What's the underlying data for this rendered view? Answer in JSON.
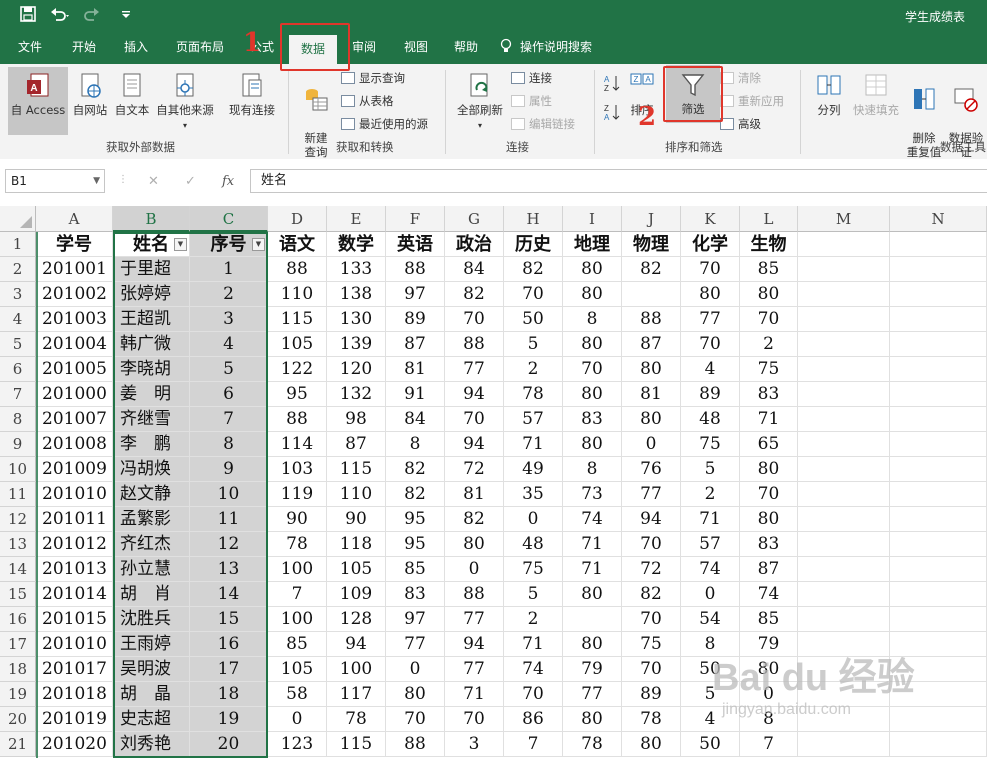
{
  "titlebar": {
    "doc_title": "学生成绩表"
  },
  "tabs": [
    "文件",
    "开始",
    "插入",
    "页面布局",
    "公式",
    "数据",
    "审阅",
    "视图",
    "帮助"
  ],
  "tell_me": "操作说明搜索",
  "ribbon": {
    "get_external": {
      "access": "自 Access",
      "web": "自网站",
      "text": "自文本",
      "other": "自其他来源",
      "existing": "现有连接",
      "group_label": "获取外部数据"
    },
    "get_transform": {
      "new_query": "新建\n查询",
      "show_queries": "显示查询",
      "from_table": "从表格",
      "recent_sources": "最近使用的源",
      "group_label": "获取和转换"
    },
    "connections": {
      "refresh_all": "全部刷新",
      "connections": "连接",
      "properties": "属性",
      "edit_links": "编辑链接",
      "group_label": "连接"
    },
    "sort_filter": {
      "sort": "排序",
      "filter": "筛选",
      "clear": "清除",
      "reapply": "重新应用",
      "advanced": "高级",
      "group_label": "排序和筛选"
    },
    "data_tools": {
      "split": "分列",
      "flash_fill": "快速填充",
      "remove_dup": "删除\n重复值",
      "validation": "数据验\n证",
      "group_label": "数据工具"
    }
  },
  "annotations": {
    "step1": "1",
    "step2": "2"
  },
  "formula_bar": {
    "name_box": "B1",
    "content": "姓名"
  },
  "columns": [
    "A",
    "B",
    "C",
    "D",
    "E",
    "F",
    "G",
    "H",
    "I",
    "J",
    "K",
    "L",
    "M",
    "N"
  ],
  "header_row": [
    "学号",
    "姓名",
    "序号",
    "语文",
    "数学",
    "英语",
    "政治",
    "历史",
    "地理",
    "物理",
    "化学",
    "生物",
    "",
    ""
  ],
  "rows": [
    [
      "201001",
      "于里超",
      "1",
      "88",
      "133",
      "88",
      "84",
      "82",
      "80",
      "82",
      "70",
      "85"
    ],
    [
      "201002",
      "张婷婷",
      "2",
      "110",
      "138",
      "97",
      "82",
      "70",
      "80",
      "",
      "80",
      "80"
    ],
    [
      "201003",
      "王超凯",
      "3",
      "115",
      "130",
      "89",
      "70",
      "50",
      "8",
      "88",
      "77",
      "70"
    ],
    [
      "201004",
      "韩广微",
      "4",
      "105",
      "139",
      "87",
      "88",
      "5",
      "80",
      "87",
      "70",
      "2"
    ],
    [
      "201005",
      "李晓胡",
      "5",
      "122",
      "120",
      "81",
      "77",
      "2",
      "70",
      "80",
      "4",
      "75"
    ],
    [
      "201000",
      "姜　明",
      "6",
      "95",
      "132",
      "91",
      "94",
      "78",
      "80",
      "81",
      "89",
      "83"
    ],
    [
      "201007",
      "齐继雪",
      "7",
      "88",
      "98",
      "84",
      "70",
      "57",
      "83",
      "80",
      "48",
      "71"
    ],
    [
      "201008",
      "李　鹏",
      "8",
      "114",
      "87",
      "8",
      "94",
      "71",
      "80",
      "0",
      "75",
      "65"
    ],
    [
      "201009",
      "冯胡焕",
      "9",
      "103",
      "115",
      "82",
      "72",
      "49",
      "8",
      "76",
      "5",
      "80"
    ],
    [
      "201010",
      "赵文静",
      "10",
      "119",
      "110",
      "82",
      "81",
      "35",
      "73",
      "77",
      "2",
      "70"
    ],
    [
      "201011",
      "孟繁影",
      "11",
      "90",
      "90",
      "95",
      "82",
      "0",
      "74",
      "94",
      "71",
      "80"
    ],
    [
      "201012",
      "齐红杰",
      "12",
      "78",
      "118",
      "95",
      "80",
      "48",
      "71",
      "70",
      "57",
      "83"
    ],
    [
      "201013",
      "孙立慧",
      "13",
      "100",
      "105",
      "85",
      "0",
      "75",
      "71",
      "72",
      "74",
      "87"
    ],
    [
      "201014",
      "胡　肖",
      "14",
      "7",
      "109",
      "83",
      "88",
      "5",
      "80",
      "82",
      "0",
      "74"
    ],
    [
      "201015",
      "沈胜兵",
      "15",
      "100",
      "128",
      "97",
      "77",
      "2",
      "",
      "70",
      "54",
      "85"
    ],
    [
      "201010",
      "王雨婷",
      "16",
      "85",
      "94",
      "77",
      "94",
      "71",
      "80",
      "75",
      "8",
      "79"
    ],
    [
      "201017",
      "吴明波",
      "17",
      "105",
      "100",
      "0",
      "77",
      "74",
      "79",
      "70",
      "50",
      "80"
    ],
    [
      "201018",
      "胡　晶",
      "18",
      "58",
      "117",
      "80",
      "71",
      "70",
      "77",
      "89",
      "5",
      "0"
    ],
    [
      "201019",
      "史志超",
      "19",
      "0",
      "78",
      "70",
      "70",
      "86",
      "80",
      "78",
      "4",
      "8"
    ],
    [
      "201020",
      "刘秀艳",
      "20",
      "123",
      "115",
      "88",
      "3",
      "7",
      "78",
      "80",
      "50",
      "7"
    ]
  ],
  "watermark": {
    "line1": "Bai du 经验",
    "line2": "jingyan.baidu.com"
  },
  "colors": {
    "excel_green": "#217346",
    "highlight_red": "#e0362b",
    "selection_gray": "#d3d3d3"
  }
}
